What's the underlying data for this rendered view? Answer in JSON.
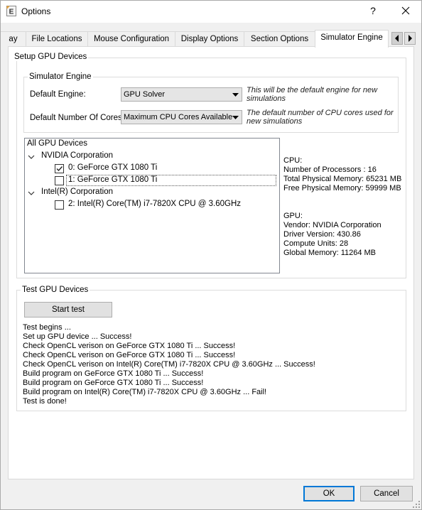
{
  "window": {
    "title": "Options",
    "help_label": "?",
    "close_label": "✕",
    "app_icon_letter": "E"
  },
  "tabs": [
    {
      "label": "ay",
      "active": false
    },
    {
      "label": "File Locations",
      "active": false
    },
    {
      "label": "Mouse Configuration",
      "active": false
    },
    {
      "label": "Display Options",
      "active": false
    },
    {
      "label": "Section Options",
      "active": false
    },
    {
      "label": "Simulator Engine",
      "active": true
    }
  ],
  "setup": {
    "title": "Setup GPU Devices",
    "engine_group_title": "Simulator Engine",
    "default_engine": {
      "label": "Default Engine:",
      "value": "GPU Solver",
      "note": "This will be the default engine for new simulations"
    },
    "default_cores": {
      "label": "Default Number Of Cores",
      "value": "Maximum CPU Cores Available",
      "note": "The default number of CPU cores used for new simulations"
    },
    "tree": {
      "root": "All GPU Devices",
      "vendors": [
        {
          "name": "NVIDIA Corporation",
          "devices": [
            {
              "label": "0: GeForce GTX 1080 Ti",
              "checked": true
            },
            {
              "label": "1: GeForce GTX 1080 Ti",
              "checked": false
            }
          ]
        },
        {
          "name": "Intel(R) Corporation",
          "devices": [
            {
              "label": "2: Intel(R) Core(TM) i7-7820X CPU @ 3.60GHz",
              "checked": false
            }
          ]
        }
      ]
    },
    "cpu_info": [
      "CPU:",
      "Number of Processors : 16",
      "Total Physical Memory: 65231 MB",
      "Free Physical Memory: 59999 MB"
    ],
    "gpu_info": [
      "GPU:",
      "Vendor: NVIDIA Corporation",
      "Driver Version: 430.86",
      "Compute Units: 28",
      "Global Memory: 11264 MB"
    ]
  },
  "test": {
    "title": "Test GPU Devices",
    "button_label": "Start test",
    "log": [
      "Test begins ...",
      "Set up GPU device ... Success!",
      "Check OpenCL verison on GeForce GTX 1080 Ti ... Success!",
      "Check OpenCL verison on GeForce GTX 1080 Ti ... Success!",
      "Check OpenCL verison on Intel(R) Core(TM) i7-7820X CPU @ 3.60GHz ... Success!",
      "Build program on GeForce GTX 1080 Ti ... Success!",
      "Build program on GeForce GTX 1080 Ti ... Success!",
      "Build program on Intel(R) Core(TM) i7-7820X CPU @ 3.60GHz ... Fail!",
      "Test is done!"
    ]
  },
  "footer": {
    "ok_label": "OK",
    "cancel_label": "Cancel"
  },
  "colors": {
    "accent": "#0078d7",
    "window_bg": "#f0f0f0",
    "panel_bg": "#ffffff"
  },
  "icons": [
    "app-icon",
    "help-icon",
    "close-icon",
    "chevron-left-icon",
    "chevron-right-icon",
    "dropdown-arrow-icon",
    "expand-arrow-icon",
    "checkmark-icon",
    "resize-grip-icon"
  ]
}
